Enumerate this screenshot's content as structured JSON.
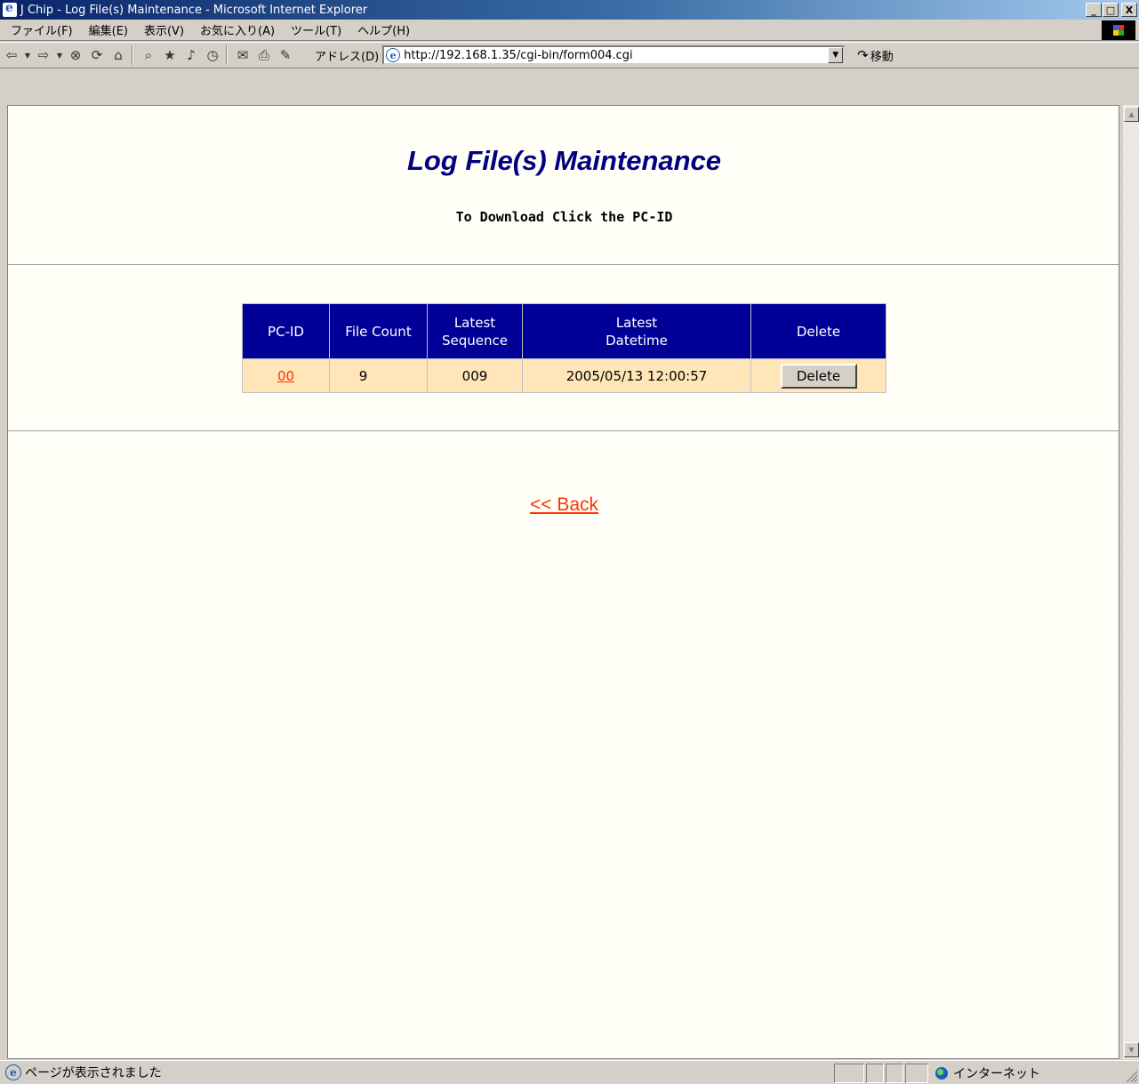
{
  "window": {
    "title": "J Chip - Log File(s) Maintenance - Microsoft Internet Explorer",
    "buttons": {
      "minimize": "_",
      "maximize": "□",
      "close": "X"
    }
  },
  "menu": [
    "ファイル(F)",
    "編集(E)",
    "表示(V)",
    "お気に入り(A)",
    "ツール(T)",
    "ヘルプ(H)"
  ],
  "toolbar": {
    "icons": [
      "back-icon",
      "forward-icon",
      "stop-icon",
      "refresh-icon",
      "home-icon",
      "search-icon",
      "favorites-icon",
      "history-icon",
      "media-icon",
      "mail-icon",
      "print-icon",
      "edit-icon"
    ],
    "address_label": "アドレス(D)",
    "address_value": "http://192.168.1.35/cgi-bin/form004.cgi",
    "go_label": "移動"
  },
  "page": {
    "title": "Log File(s) Maintenance",
    "subtitle": "To Download Click the PC-ID",
    "table": {
      "headers": {
        "pcid": "PC-ID",
        "file_count": "File Count",
        "latest_sequence_1": "Latest",
        "latest_sequence_2": "Sequence",
        "latest_datetime_1": "Latest",
        "latest_datetime_2": "Datetime",
        "delete": "Delete"
      },
      "rows": [
        {
          "pcid": "00",
          "file_count": "9",
          "latest_sequence": "009",
          "latest_datetime": "2005/05/13 12:00:57",
          "delete_label": "Delete"
        }
      ]
    },
    "back_link": "<<  Back"
  },
  "status": {
    "text": "ページが表示されました",
    "zone": "インターネット"
  }
}
